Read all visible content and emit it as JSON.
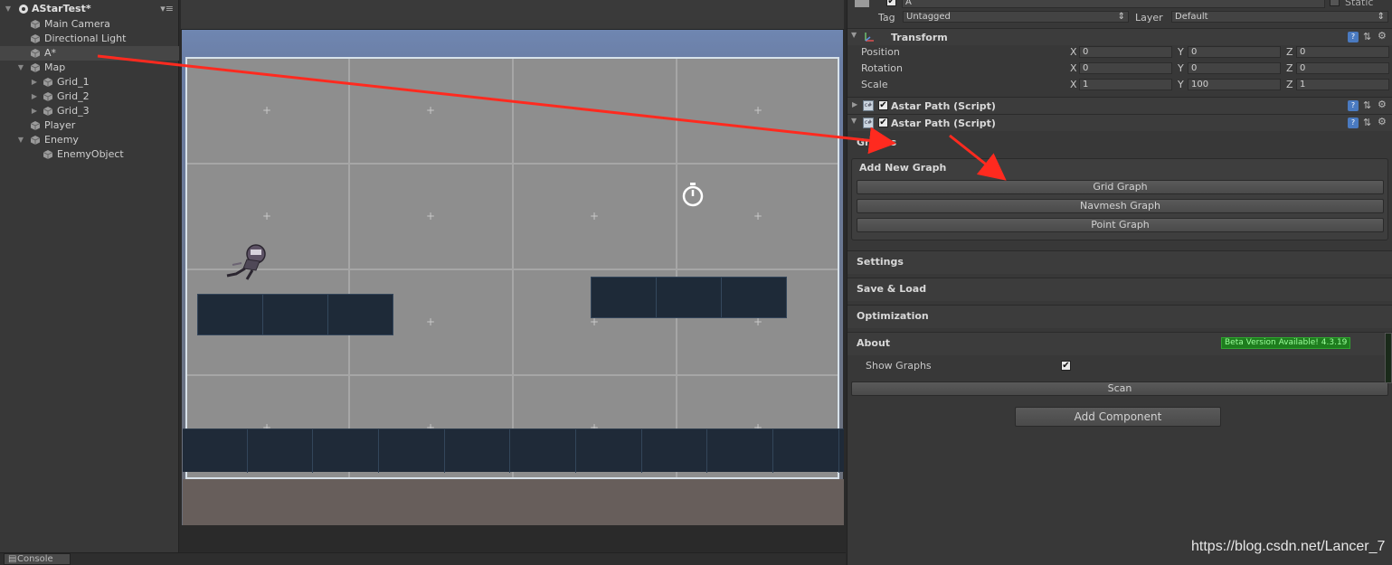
{
  "hierarchy": {
    "scene_name": "AStarTest*",
    "items": [
      {
        "label": "Main Camera"
      },
      {
        "label": "Directional Light"
      },
      {
        "label": "A*"
      },
      {
        "label": "Map"
      },
      {
        "label": "Grid_1"
      },
      {
        "label": "Grid_2"
      },
      {
        "label": "Grid_3"
      },
      {
        "label": "Player"
      },
      {
        "label": "Enemy"
      },
      {
        "label": "EnemyObject"
      }
    ]
  },
  "inspector": {
    "object_name": "A",
    "static_label": "Static",
    "tag_label": "Tag",
    "tag_value": "Untagged",
    "layer_label": "Layer",
    "layer_value": "Default",
    "transform": {
      "title": "Transform",
      "position_label": "Position",
      "rotation_label": "Rotation",
      "scale_label": "Scale",
      "axis_x": "X",
      "axis_y": "Y",
      "axis_z": "Z",
      "position": {
        "x": "0",
        "y": "0",
        "z": "0"
      },
      "rotation": {
        "x": "0",
        "y": "0",
        "z": "0"
      },
      "scale": {
        "x": "1",
        "y": "100",
        "z": "1"
      }
    },
    "components": [
      {
        "title": "Astar Path (Script)"
      },
      {
        "title": "Astar Path (Script)"
      }
    ],
    "graphs_label": "Graphs",
    "add_new_graph": "Add New Graph",
    "graph_buttons": [
      "Grid Graph",
      "Navmesh Graph",
      "Point Graph"
    ],
    "sections": [
      "Settings",
      "Save & Load",
      "Optimization",
      "About"
    ],
    "beta_badge": "Beta Version Available! 4.3.19",
    "show_graphs_label": "Show Graphs",
    "scan_button": "Scan",
    "add_component_button": "Add Component"
  },
  "bottom": {
    "console_tab": "Console"
  },
  "watermark": "https://blog.csdn.net/Lancer_7",
  "colors": {
    "panel_bg": "#383838",
    "annotation_arrow": "#ff2a1f",
    "beta_badge_bg": "#1e7d1e"
  }
}
